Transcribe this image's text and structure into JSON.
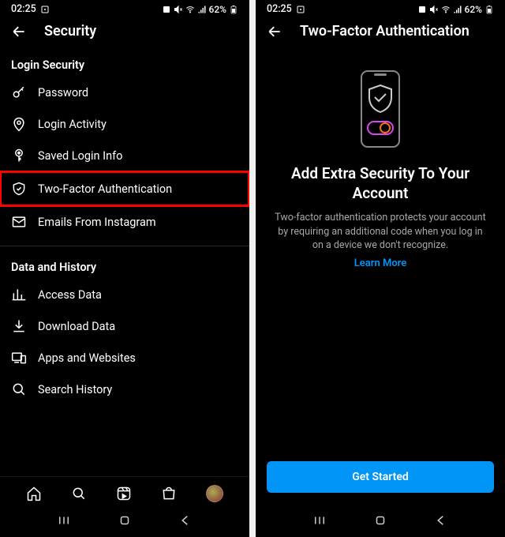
{
  "status": {
    "time": "02:25",
    "battery": "62%"
  },
  "left": {
    "title": "Security",
    "sections": [
      {
        "label": "Login Security"
      },
      {
        "label": "Data and History"
      }
    ],
    "items": {
      "password": "Password",
      "login_activity": "Login Activity",
      "saved_login": "Saved Login Info",
      "tfa": "Two-Factor Authentication",
      "emails": "Emails From Instagram",
      "access_data": "Access Data",
      "download_data": "Download Data",
      "apps_web": "Apps and Websites",
      "search_history": "Search History"
    }
  },
  "right": {
    "title": "Two-Factor Authentication",
    "heading": "Add Extra Security To Your Account",
    "desc": "Two-factor authentication protects your account by requiring an additional code when you log in on a device we don't recognize.",
    "learn_more": "Learn More",
    "cta": "Get Started"
  }
}
